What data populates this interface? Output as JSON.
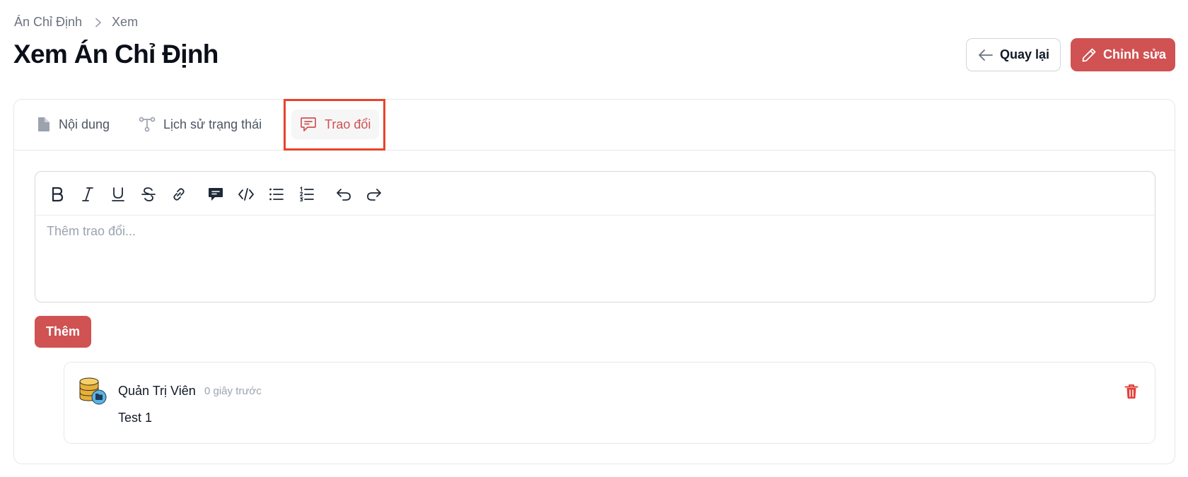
{
  "breadcrumb": {
    "parent": "Án Chỉ Định",
    "current": "Xem"
  },
  "page": {
    "title": "Xem Án Chỉ Định"
  },
  "actions": {
    "back_label": "Quay lại",
    "edit_label": "Chỉnh sửa"
  },
  "tabs": [
    {
      "label": "Nội dung",
      "icon": "document-icon",
      "active": false
    },
    {
      "label": "Lịch sử trạng thái",
      "icon": "workflow-icon",
      "active": false
    },
    {
      "label": "Trao đổi",
      "icon": "chat-bubble-icon",
      "active": true
    }
  ],
  "editor": {
    "placeholder": "Thêm trao đổi...",
    "value": "",
    "toolbar": [
      "bold-icon",
      "italic-icon",
      "underline-icon",
      "strikethrough-icon",
      "link-icon",
      "blockquote-icon",
      "code-icon",
      "bullet-list-icon",
      "ordered-list-icon",
      "undo-icon",
      "redo-icon"
    ]
  },
  "add_button": {
    "label": "Thêm"
  },
  "comments": [
    {
      "author": "Quản Trị Viên",
      "time": "0 giây trước",
      "body": "Test 1",
      "avatar": "database-avatar-icon",
      "delete_icon": "trash-icon"
    }
  ],
  "colors": {
    "primary": "#d05252",
    "highlight": "#e8432b",
    "border": "#e5e7eb",
    "muted": "#6b7280"
  }
}
